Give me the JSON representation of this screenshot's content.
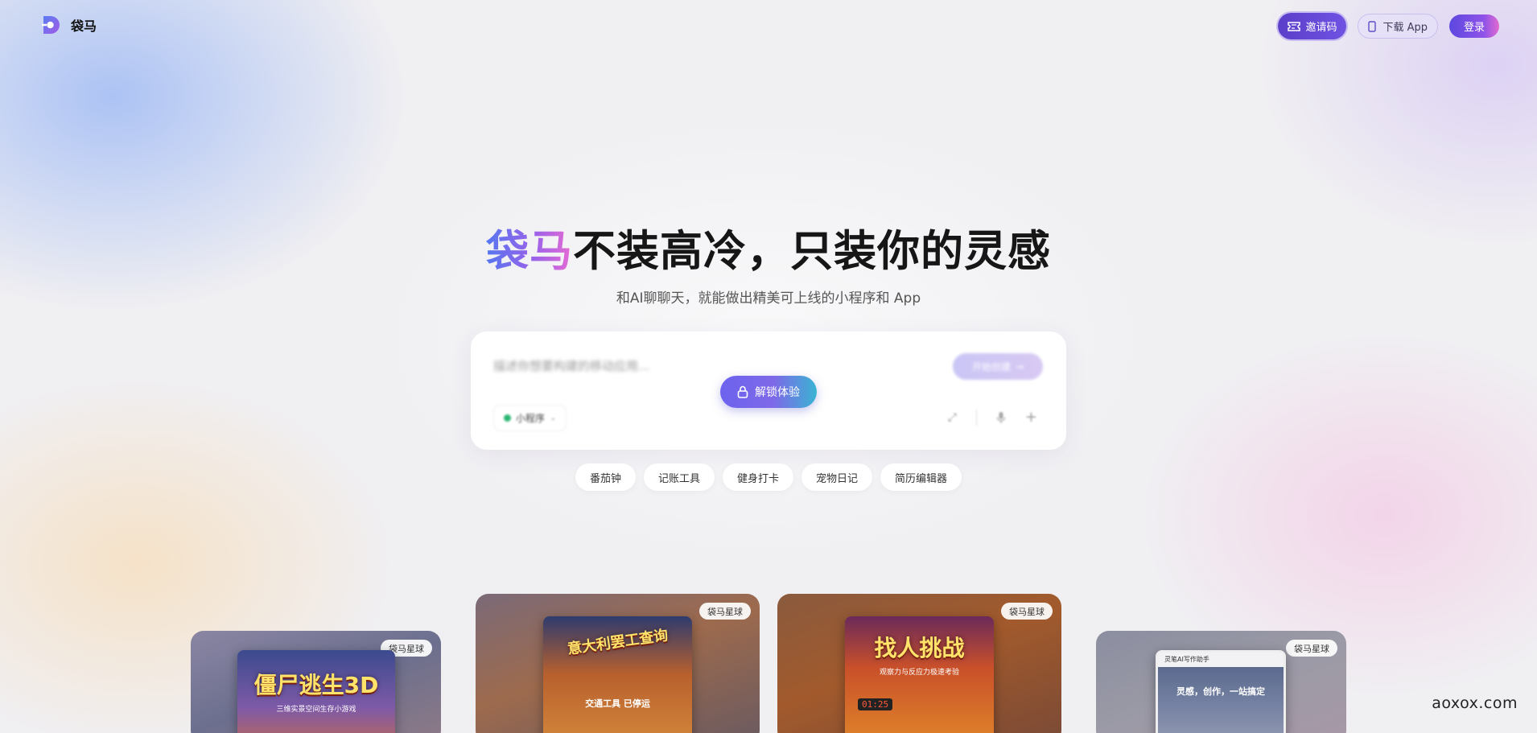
{
  "header": {
    "brand": "袋马",
    "invite_label": "邀请码",
    "download_label": "下载 App",
    "login_label": "登录"
  },
  "hero": {
    "title_brand": "袋马",
    "title_rest": "不装高冷，只装你的灵感",
    "subtitle": "和AI聊聊天，就能做出精美可上线的小程序和 App"
  },
  "prompt": {
    "placeholder": "描述你想要构建的移动应用...",
    "create_label": "开始创建",
    "unlock_label": "解锁体验",
    "platform": "小程序"
  },
  "suggestions": [
    "番茄钟",
    "记账工具",
    "健身打卡",
    "宠物日记",
    "简历编辑器"
  ],
  "showcase": [
    {
      "tag": "袋马星球",
      "title": "僵尸逃生3D",
      "subtitle": "三维实景空间生存小游戏"
    },
    {
      "tag": "袋马星球",
      "title": "意大利罢工查询",
      "subtitle": "交通工具 已停运"
    },
    {
      "tag": "袋马星球",
      "title": "找人挑战",
      "subtitle": "观察力与反应力极速考验",
      "timer": "01:25"
    },
    {
      "tag": "袋马星球",
      "title": "灵笔AI写作助手",
      "subtitle": "灵感，创作，一站搞定"
    }
  ],
  "watermark": "aoxox.com",
  "colors": {
    "accent": "#6c5ce7",
    "login_gradient_end": "#e26bd0",
    "unlock_gradient_end": "#3ab3d3"
  }
}
